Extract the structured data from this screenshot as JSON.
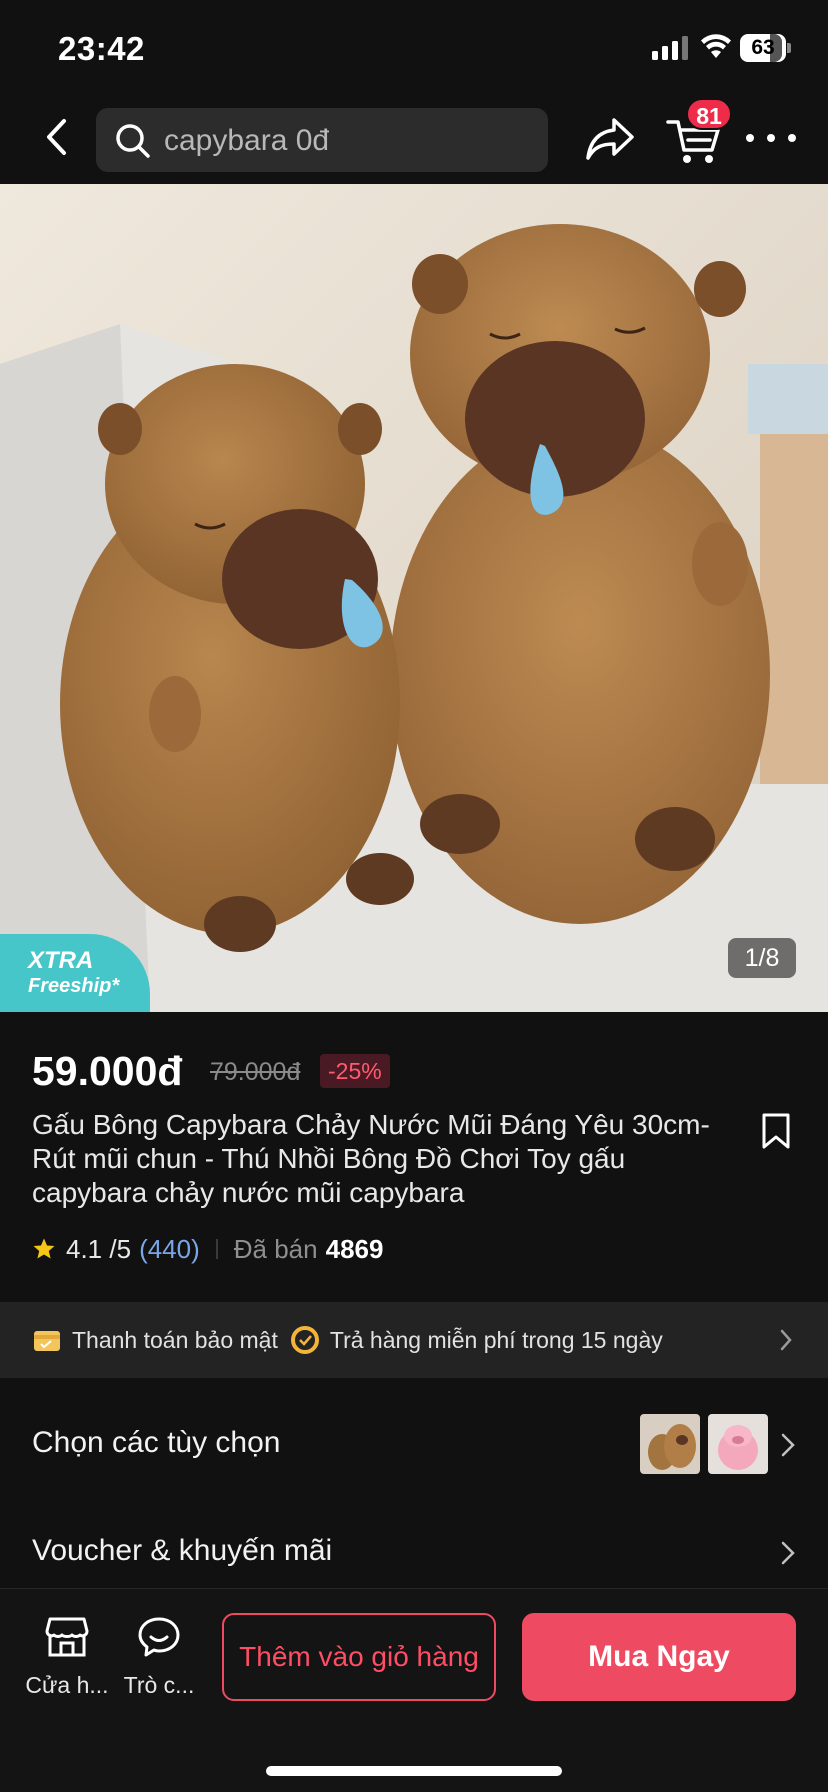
{
  "status_bar": {
    "time": "23:42",
    "battery": "63"
  },
  "nav": {
    "search_text": "capybara 0đ",
    "cart_badge": "81"
  },
  "product": {
    "image_counter": "1/8",
    "xtra_badge": {
      "title": "XTRA",
      "subtitle": "Freeship*"
    },
    "price": "59.000đ",
    "old_price": "79.000đ",
    "discount": "-25%",
    "title": "Gấu Bông Capybara Chảy Nước Mũi Đáng Yêu 30cm-Rút mũi chun - Thú Nhồi Bông Đồ Chơi Toy gấu capybara  chảy nước mũi capybara",
    "rating": "4.1 /5",
    "rating_count": "(440)",
    "sold_label": "Đã bán",
    "sold_count": "4869"
  },
  "guarantee": {
    "secure_payment": "Thanh toán bảo mật",
    "free_return": "Trả hàng miễn phí trong 15 ngày"
  },
  "options_row": {
    "label": "Chọn các tùy chọn"
  },
  "voucher_row": {
    "label": "Voucher & khuyến mãi"
  },
  "bottom_bar": {
    "shop_label": "Cửa h...",
    "chat_label": "Trò c...",
    "add_to_cart": "Thêm vào giỏ hàng",
    "buy_now": "Mua Ngay"
  },
  "colors": {
    "accent": "#ee4b62",
    "badge": "#ee2c4a",
    "link": "#7aa5e8",
    "xtra": "#46c6c9"
  }
}
